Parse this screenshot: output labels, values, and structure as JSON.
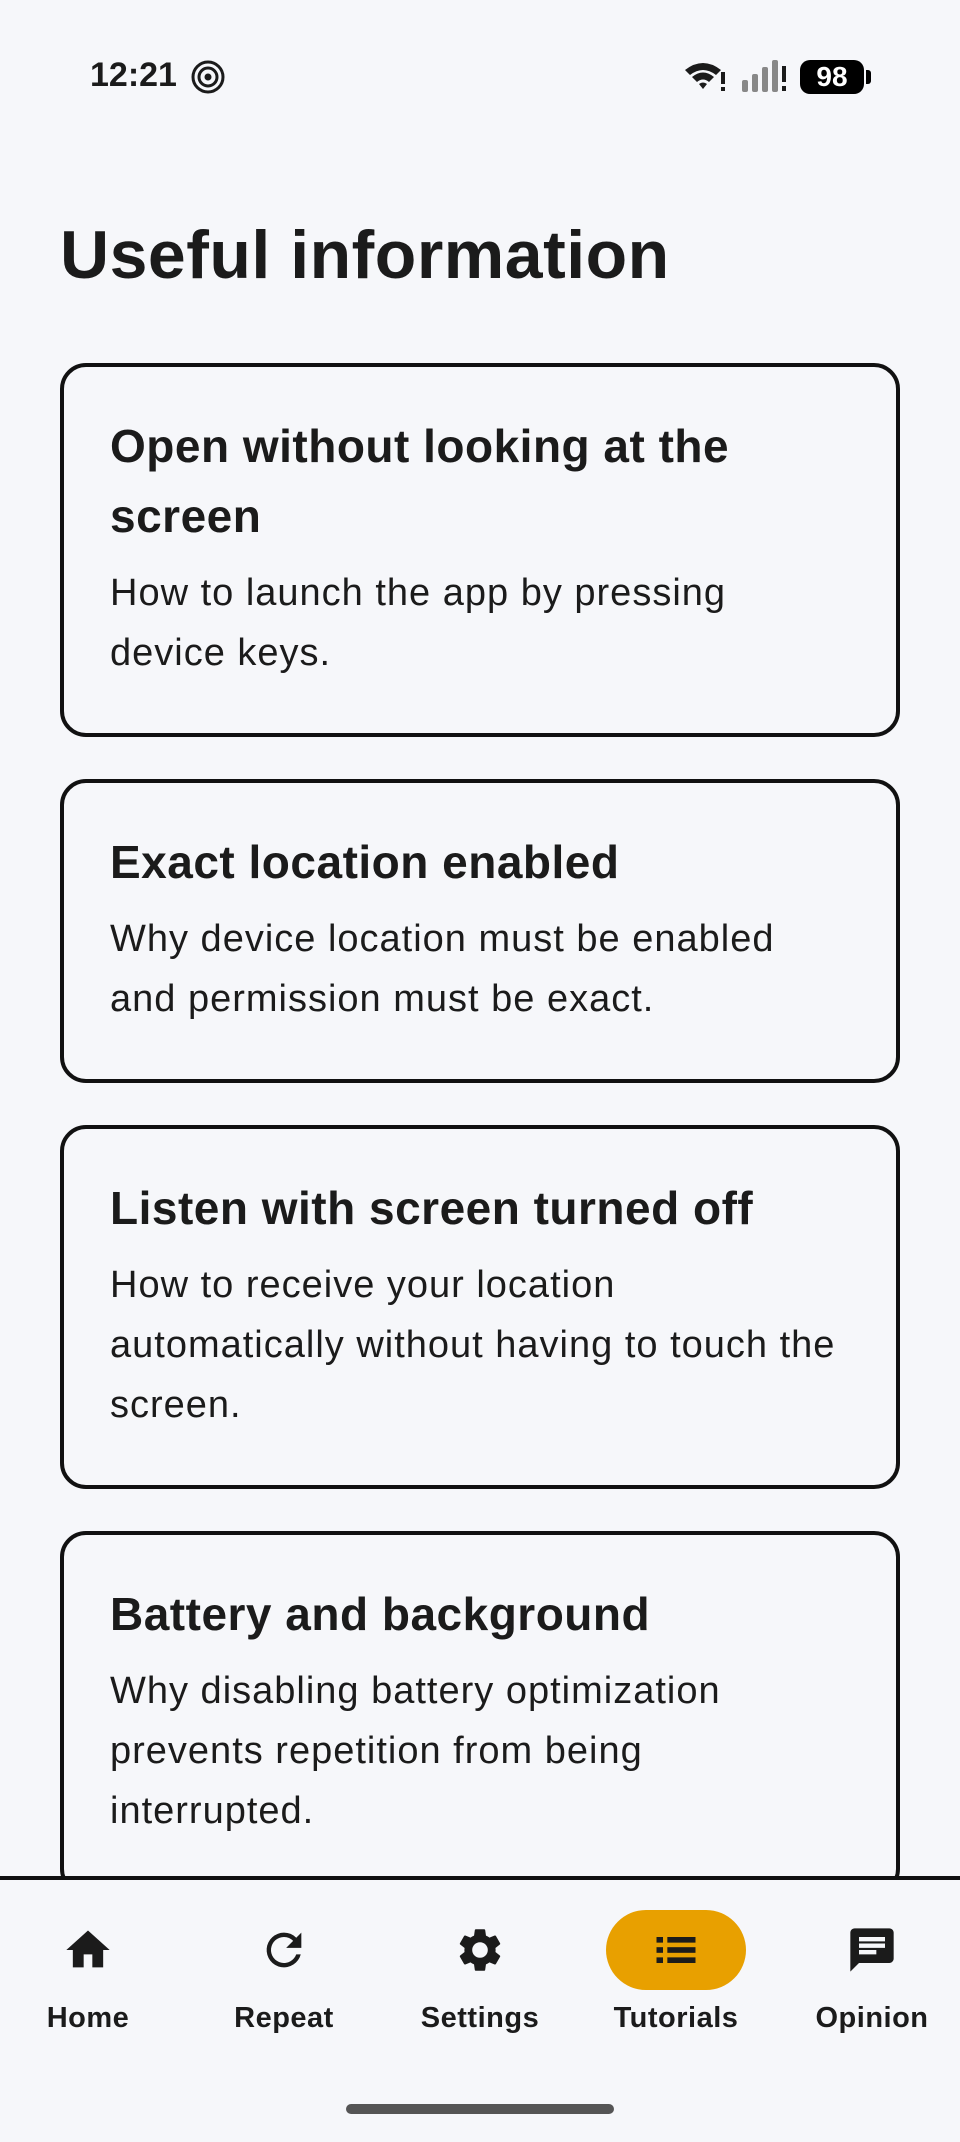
{
  "status_bar": {
    "time": "12:21",
    "battery": "98"
  },
  "page": {
    "title": "Useful information"
  },
  "cards": [
    {
      "title": "Open without looking at the screen",
      "description": "How to launch the app by pressing device keys."
    },
    {
      "title": "Exact location enabled",
      "description": "Why device location must be enabled and permission must be exact."
    },
    {
      "title": "Listen with screen turned off",
      "description": "How to receive your location automatically without having to touch the screen."
    },
    {
      "title": "Battery and background",
      "description": "Why disabling battery optimization prevents repetition from being interrupted."
    }
  ],
  "bottom_nav": {
    "items": [
      {
        "label": "Home",
        "icon": "home-icon",
        "active": false
      },
      {
        "label": "Repeat",
        "icon": "refresh-icon",
        "active": false
      },
      {
        "label": "Settings",
        "icon": "gear-icon",
        "active": false
      },
      {
        "label": "Tutorials",
        "icon": "list-icon",
        "active": true
      },
      {
        "label": "Opinion",
        "icon": "chat-bubble-icon",
        "active": false
      }
    ],
    "active_color": "#e8a000"
  }
}
